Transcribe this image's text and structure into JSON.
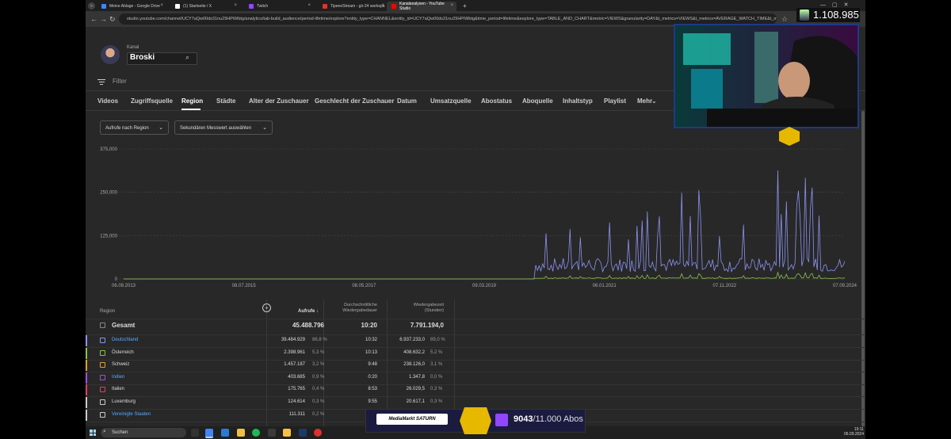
{
  "browser": {
    "tabs": [
      {
        "label": "Meine Ablage - Google Drive",
        "color": "#4285f4",
        "active": false
      },
      {
        "label": "(1) Startseite / X",
        "color": "#ffffff",
        "active": false
      },
      {
        "label": "Twitch",
        "color": "#9146ff",
        "active": false
      },
      {
        "label": "TipeeeStream - gö-24 workspa",
        "color": "#d33",
        "active": false
      },
      {
        "label": "Kanalanalysen - YouTube Studio",
        "color": "#ff0000",
        "active": true
      }
    ],
    "url": "studio.youtube.com/channel/UCY7aQw00ds31nu29HPiWbtg/analytics/tab-build_audience/period-lifetime/explore?entity_type=CHANNEL&entity_id=UCY7aQw00ds31nu29HPiWbtg&time_period=lifetime&explore_type=TABLE_AND_CHART&metric=VIEWS&granularity=DAY&t_metrics=VIEWS&t_metrics=AVERAGE_WATCH_TIME&t_metrics=..."
  },
  "channel": {
    "label": "Kanal",
    "name": "Broski"
  },
  "filter": {
    "placeholder": "Filter"
  },
  "nav_tabs": [
    "Videos",
    "Zugriffsquelle",
    "Region",
    "Städte",
    "Alter der Zuschauer",
    "Geschlecht der Zuschauer",
    "Datum",
    "Umsatzquelle",
    "Abostatus",
    "Aboquelle",
    "Inhaltstyp",
    "Playlist",
    "Mehr"
  ],
  "active_tab": "Region",
  "dropdowns": {
    "primary": "Aufrufe nach Region",
    "secondary": "Sekundären Messwert auswählen"
  },
  "chart_data": {
    "type": "line",
    "ylim": [
      0,
      375000
    ],
    "y_ticks": [
      "375,000",
      "250,000",
      "125,000",
      "0"
    ],
    "x_ticks": [
      "06.09.2013",
      "08.07.2015",
      "08.05.2017",
      "09.03.2019",
      "06.01.2021",
      "07.11.2022",
      "07.09.2024"
    ],
    "series": [
      {
        "name": "Deutschland",
        "color": "#8b93f0"
      },
      {
        "name": "Österreich",
        "color": "#8bc34a"
      }
    ],
    "grid": true
  },
  "table": {
    "headers": {
      "region": "Region",
      "views": "Aufrufe",
      "avg_duration": [
        "Durchschnittliche",
        "Wiedergabedauer"
      ],
      "watch_time": [
        "Wiedergabezeit",
        "(Stunden)"
      ]
    },
    "total": {
      "label": "Gesamt",
      "views": "45.488.796",
      "avg_duration": "10:20",
      "watch_time": "7.791.194,0"
    },
    "rows": [
      {
        "region": "Deutschland",
        "link": true,
        "views": "39.484.929",
        "views_pct": "86,8 %",
        "avg_duration": "10:32",
        "watch_time": "6.937.233,0",
        "watch_pct": "89,0 %",
        "color": "#8b93f0"
      },
      {
        "region": "Österreich",
        "link": false,
        "views": "2.398.961",
        "views_pct": "5,3 %",
        "avg_duration": "10:13",
        "watch_time": "408.632,2",
        "watch_pct": "5,2 %",
        "color": "#8bc34a"
      },
      {
        "region": "Schweiz",
        "link": false,
        "views": "1.457.187",
        "views_pct": "3,2 %",
        "avg_duration": "9:48",
        "watch_time": "238.126,0",
        "watch_pct": "3,1 %",
        "color": "#e0a030"
      },
      {
        "region": "Indien",
        "link": true,
        "views": "403.685",
        "views_pct": "0,9 %",
        "avg_duration": "0:20",
        "watch_time": "1.347,8",
        "watch_pct": "0,0 %",
        "color": "#a050e0"
      },
      {
        "region": "Italien",
        "link": false,
        "views": "175.765",
        "views_pct": "0,4 %",
        "avg_duration": "8:53",
        "watch_time": "26.029,5",
        "watch_pct": "0,3 %",
        "color": "#e04060"
      },
      {
        "region": "Luxemburg",
        "link": false,
        "views": "124.614",
        "views_pct": "0,3 %",
        "avg_duration": "9:55",
        "watch_time": "20.617,1",
        "watch_pct": "0,3 %",
        "color": "#cccccc"
      },
      {
        "region": "Vereinigte Staaten",
        "link": true,
        "views": "111.311",
        "views_pct": "0,2 %",
        "avg_duration": "",
        "watch_time": "",
        "watch_pct": "",
        "color": "#cccccc"
      }
    ]
  },
  "taskbar": {
    "search": "Suchen",
    "time": "19:11",
    "date": "06.09.2024"
  },
  "overlays": {
    "viewer_count": "1.108.985",
    "subs_current": "9043",
    "subs_goal": "/11.000 Abos",
    "sponsor": "MediaMarkt SATURN"
  }
}
